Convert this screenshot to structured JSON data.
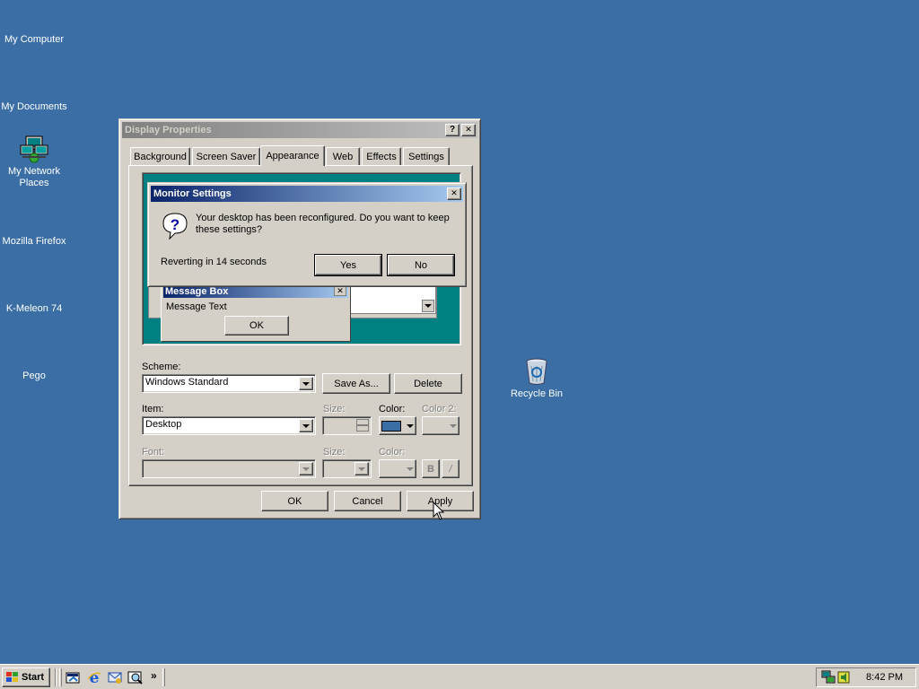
{
  "desktop": {
    "background": "#3a6ea5",
    "icons": [
      {
        "label": "My Computer",
        "icon": "my-computer-icon"
      },
      {
        "label": "My Documents",
        "icon": "my-documents-icon"
      },
      {
        "label": "My Network Places",
        "icon": "network-places-icon"
      },
      {
        "label": "Mozilla Firefox",
        "icon": "firefox-icon"
      },
      {
        "label": "K-Meleon 74",
        "icon": "k-meleon-icon"
      },
      {
        "label": "Pego",
        "icon": "pego-icon"
      },
      {
        "label": "Recycle Bin",
        "icon": "recycle-bin-icon"
      }
    ]
  },
  "display_properties": {
    "title": "Display Properties",
    "help_glyph": "?",
    "close_glyph": "✕",
    "tabs": [
      "Background",
      "Screen Saver",
      "Appearance",
      "Web",
      "Effects",
      "Settings"
    ],
    "active_tab": "Appearance",
    "preview": {
      "message_box_title": "Message Box",
      "message_text": "Message Text",
      "ok_label": "OK"
    },
    "scheme_label": "Scheme:",
    "scheme_value": "Windows Standard",
    "save_as_label": "Save As...",
    "delete_label": "Delete",
    "item_label": "Item:",
    "item_value": "Desktop",
    "size_label": "Size:",
    "color_label": "Color:",
    "color2_label": "Color 2:",
    "font_label": "Font:",
    "font_size_label": "Size:",
    "font_color_label": "Color:",
    "bold_label": "B",
    "italic_label": "/",
    "item_color": "#3a6ea5",
    "ok_label": "OK",
    "cancel_label": "Cancel",
    "apply_label": "Apply"
  },
  "monitor_settings": {
    "title": "Monitor Settings",
    "close_glyph": "✕",
    "message": "Your desktop has been reconfigured.  Do you want to keep these settings?",
    "countdown": "Reverting in 14 seconds",
    "yes_label": "Yes",
    "no_label": "No"
  },
  "taskbar": {
    "start_label": "Start",
    "chevron": "»",
    "clock": "8:42 PM"
  },
  "colors": {
    "titlebar_active": "#0a246a",
    "titlebar_active_end": "#a6caf0",
    "titlebar_inactive": "#808080",
    "titlebar_inactive_end": "#c0c0c0",
    "face": "#d4d0c8",
    "preview_bg": "#008080"
  }
}
